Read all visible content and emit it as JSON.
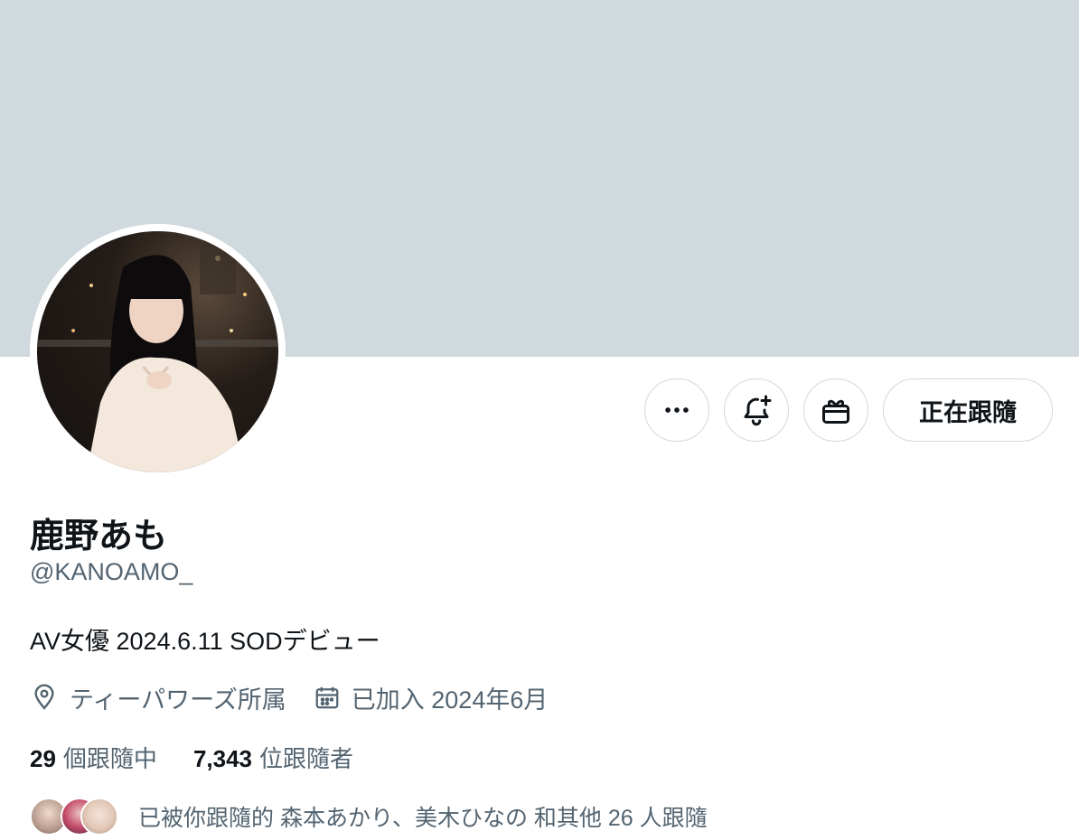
{
  "profile": {
    "display_name": "鹿野あも",
    "handle": "@KANOAMO_",
    "bio": "AV女優 2024.6.11 SODデビュー",
    "location": "ティーパワーズ所属",
    "joined": "已加入 2024年6月"
  },
  "actions": {
    "more_icon": "more-horizontal-icon",
    "notify_icon": "bell-plus-icon",
    "gift_icon": "gift-icon",
    "follow_label": "正在跟隨"
  },
  "stats": {
    "following_count": "29",
    "following_label": "個跟隨中",
    "followers_count": "7,343",
    "followers_label": "位跟隨者"
  },
  "followed_by": {
    "text": "已被你跟隨的 森本あかり、美木ひなの 和其他 26 人跟隨"
  },
  "colors": {
    "banner": "#cfd9de",
    "text_primary": "#0f1419",
    "text_secondary": "#536471",
    "border": "#cfd9de"
  }
}
